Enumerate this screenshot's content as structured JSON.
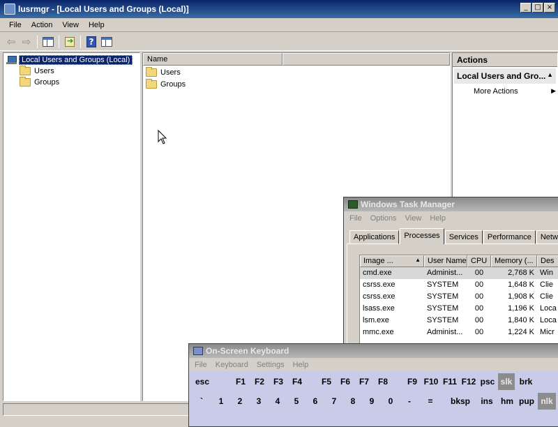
{
  "main_window": {
    "title": "lusrmgr - [Local Users and Groups (Local)]",
    "controls": [
      "_",
      "□",
      "×"
    ],
    "menu": [
      "File",
      "Action",
      "View",
      "Help"
    ],
    "toolbar_icons": [
      "back-arrow-icon",
      "forward-arrow-icon",
      "show-hide-tree-icon",
      "export-list-icon",
      "help-icon",
      "show-hide-action-pane-icon"
    ],
    "tree": {
      "root": "Local Users and Groups (Local)",
      "children": [
        "Users",
        "Groups"
      ]
    },
    "list": {
      "columns": [
        "Name",
        ""
      ],
      "items": [
        "Users",
        "Groups"
      ]
    },
    "actions": {
      "header": "Actions",
      "section": "Local Users and Gro...",
      "items": [
        "More Actions"
      ]
    }
  },
  "task_manager": {
    "title": "Windows Task Manager",
    "menu": [
      "File",
      "Options",
      "View",
      "Help"
    ],
    "tabs": [
      "Applications",
      "Processes",
      "Services",
      "Performance",
      "Network"
    ],
    "active_tab": "Processes",
    "columns": [
      "Image ...",
      "User Name",
      "CPU",
      "Memory (...",
      "Des"
    ],
    "rows": [
      {
        "image": "cmd.exe",
        "user": "Administ...",
        "cpu": "00",
        "memory": "2,768 K",
        "desc": "Win"
      },
      {
        "image": "csrss.exe",
        "user": "SYSTEM",
        "cpu": "00",
        "memory": "1,648 K",
        "desc": "Clie"
      },
      {
        "image": "csrss.exe",
        "user": "SYSTEM",
        "cpu": "00",
        "memory": "1,908 K",
        "desc": "Clie"
      },
      {
        "image": "lsass.exe",
        "user": "SYSTEM",
        "cpu": "00",
        "memory": "1,196 K",
        "desc": "Loca"
      },
      {
        "image": "lsm.exe",
        "user": "SYSTEM",
        "cpu": "00",
        "memory": "1,840 K",
        "desc": "Loca"
      },
      {
        "image": "mmc.exe",
        "user": "Administ...",
        "cpu": "00",
        "memory": "1,224 K",
        "desc": "Micr"
      }
    ]
  },
  "osk": {
    "title": "On-Screen Keyboard",
    "menu": [
      "File",
      "Keyboard",
      "Settings",
      "Help"
    ],
    "row1": [
      "esc",
      "F1",
      "F2",
      "F3",
      "F4",
      "F5",
      "F6",
      "F7",
      "F8",
      "F9",
      "F10",
      "F11",
      "F12",
      "psc",
      "slk",
      "brk"
    ],
    "row2": [
      "`",
      "1",
      "2",
      "3",
      "4",
      "5",
      "6",
      "7",
      "8",
      "9",
      "0",
      "-",
      "=",
      "bksp",
      "ins",
      "hm",
      "pup",
      "nlk"
    ],
    "toggled_keys": [
      "slk",
      "nlk"
    ]
  }
}
